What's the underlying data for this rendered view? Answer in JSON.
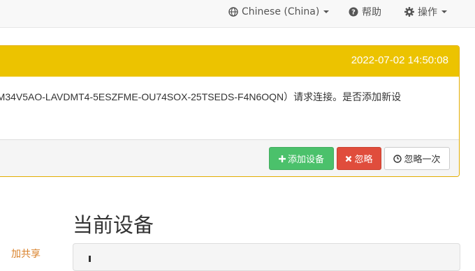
{
  "navbar": {
    "language": "Chinese (China)",
    "help": "帮助",
    "actions": "操作"
  },
  "notification": {
    "timestamp": "2022-07-02 14:50:08",
    "message": "-M34V5AO-LAVDMT4-5ESZFME-OU74SOX-25TSEDS-F4N6OQN）请求连接。是否添加新设",
    "buttons": {
      "add": "添加设备",
      "ignore": "忽略",
      "ignore_once": "忽略一次"
    }
  },
  "section": {
    "title": "当前设备",
    "left_link": "加共享"
  },
  "colors": {
    "accent": "#ecc300",
    "success": "#4bc16b",
    "danger": "#e04d3c"
  },
  "icons": [
    "globe-icon",
    "question-circle-icon",
    "gear-icon",
    "plus-icon",
    "times-icon",
    "clock-icon",
    "device-icon"
  ]
}
